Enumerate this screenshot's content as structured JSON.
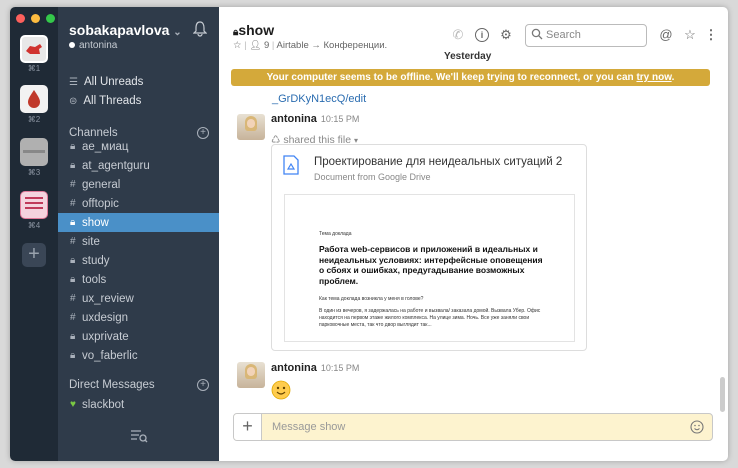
{
  "teams": [
    {
      "shortcut": "⌘1",
      "color": "#e8e8e8"
    },
    {
      "shortcut": "⌘2",
      "color": "#c0392b"
    },
    {
      "shortcut": "⌘3",
      "color": "#b0b0b0"
    },
    {
      "shortcut": "⌘4",
      "color": "#e07a9a"
    }
  ],
  "sidebar": {
    "team_name": "sobakapavlova",
    "team_chevron": "⌄",
    "user_name": "antonina",
    "nav": [
      {
        "label": "All Unreads",
        "icon": "all-unreads-icon"
      },
      {
        "label": "All Threads",
        "icon": "threads-icon"
      }
    ],
    "channels_title": "Channels",
    "channels": [
      {
        "name": "ae_миац",
        "private": true,
        "active": false
      },
      {
        "name": "at_agentguru",
        "private": true,
        "active": false
      },
      {
        "name": "general",
        "private": false,
        "active": false
      },
      {
        "name": "offtopic",
        "private": false,
        "active": false
      },
      {
        "name": "show",
        "private": true,
        "active": true
      },
      {
        "name": "site",
        "private": false,
        "active": false
      },
      {
        "name": "study",
        "private": true,
        "active": false
      },
      {
        "name": "tools",
        "private": true,
        "active": false
      },
      {
        "name": "ux_review",
        "private": false,
        "active": false
      },
      {
        "name": "uxdesign",
        "private": false,
        "active": false
      },
      {
        "name": "uxprivate",
        "private": true,
        "active": false
      },
      {
        "name": "vo_faberlic",
        "private": true,
        "active": false
      }
    ],
    "dm_title": "Direct Messages",
    "dms": [
      {
        "name": "slackbot",
        "status": "online"
      }
    ]
  },
  "header": {
    "channel_name": "show",
    "members": "9",
    "topic": "Airtable → Конференции.",
    "search_placeholder": "Search"
  },
  "messages": {
    "day_divider": "Yesterday",
    "banner_text": "Your computer seems to be offline. We'll keep trying to reconnect, or you can",
    "banner_link": "try now",
    "banner_end": ".",
    "link_tail": "_GrDKyN1ecQ/edit",
    "msg1": {
      "author": "antonina",
      "time": "10:15 PM",
      "shared": "shared this file"
    },
    "file": {
      "title": "Проектирование для неидеальных ситуаций 2",
      "subtitle": "Document from Google Drive",
      "preview_small": "Тема доклада",
      "preview_heading": "Работа web-сервисов и приложений в идеальных и неидеальных условиях: интерфейсные оповещения о сбоях и ошибках, предугадывание возможных проблем.",
      "preview_question": "Как тема доклада возникла у меня в голове?",
      "preview_body": "В один из вечеров, я задержалась на работе и вызвала/ заказала домой. Вызвала Убер. Офис находится на первом этаже жилого комплекса. На улице зима. Ночь. Все уже заняли свои парковочные места, так что двор выглядит так..."
    },
    "msg2": {
      "author": "antonina",
      "time": "10:15 PM"
    }
  },
  "composer": {
    "placeholder": "Message show"
  }
}
